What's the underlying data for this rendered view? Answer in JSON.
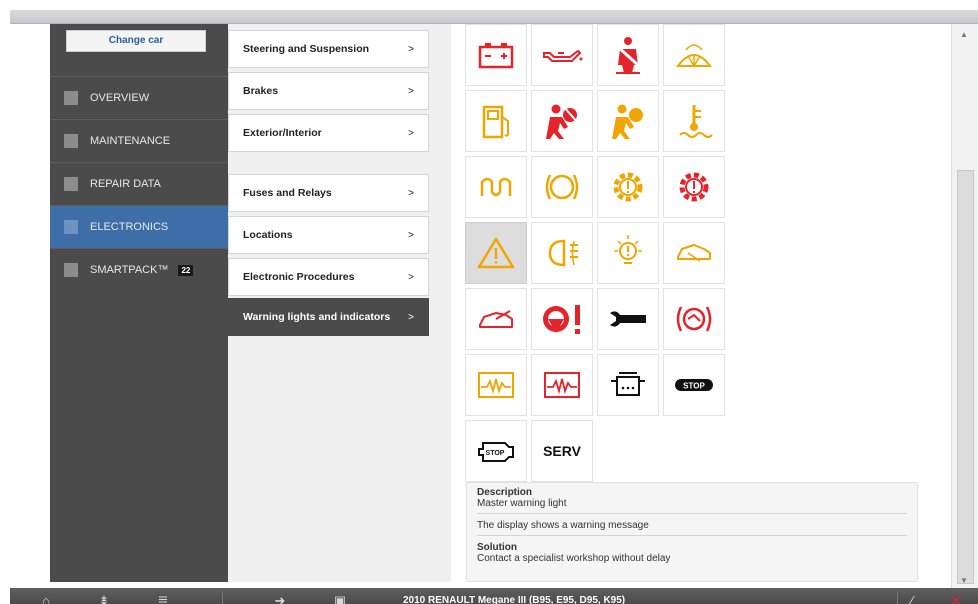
{
  "leftnav": {
    "change_car": "Change car",
    "items": [
      {
        "label": "OVERVIEW"
      },
      {
        "label": "MAINTENANCE"
      },
      {
        "label": "REPAIR DATA"
      },
      {
        "label": "ELECTRONICS"
      },
      {
        "label": "SMARTPACK™",
        "badge": "22"
      }
    ],
    "active": "ELECTRONICS"
  },
  "menu": {
    "items": [
      {
        "label": "Steering and Suspension",
        "chevron": ">"
      },
      {
        "label": "Brakes",
        "chevron": ">"
      },
      {
        "label": "Exterior/Interior",
        "chevron": ">"
      },
      {
        "label": "Fuses and Relays",
        "chevron": ">"
      },
      {
        "label": "Locations",
        "chevron": ">"
      },
      {
        "label": "Electronic Procedures",
        "chevron": ">"
      },
      {
        "label": "Warning lights and indicators",
        "chevron": ">"
      }
    ],
    "active": "Warning lights and indicators"
  },
  "icons": {
    "rows": [
      [
        "battery-warning-icon",
        "oil-pressure-icon",
        "seatbelt-icon",
        "windscreen-washer-icon"
      ],
      [
        "fuel-icon",
        "airbag-off-icon",
        "airbag-icon",
        "coolant-temp-icon"
      ],
      [
        "glow-plug-icon",
        "brake-pad-wear-icon",
        "automatic-transmission-warning-icon",
        "automatic-transmission-fault-icon"
      ],
      [
        "master-warning-icon",
        "rear-fog-light-icon",
        "bulb-failure-icon",
        "door-open-icon"
      ],
      [
        "car-ajar-icon",
        "power-steering-icon",
        "service-wrench-icon",
        "parking-brake-icon"
      ],
      [
        "exhaust-emission-icon",
        "electronic-fault-icon",
        "particle-filter-icon",
        "stop-icon"
      ],
      [
        "engine-stop-icon",
        "serv-icon"
      ]
    ],
    "selected": "master-warning-icon",
    "stop_text": "STOP",
    "serv_text": "SERV",
    "colors": {
      "red": "#e5232b",
      "amber": "#f0a500",
      "black": "#111111"
    }
  },
  "description": {
    "heading": "Description",
    "text": "Master warning light",
    "message": "The display shows a warning message",
    "solution_heading": "Solution",
    "solution": "Contact a specialist workshop without delay"
  },
  "toolbar": {
    "vehicle": "2010 RENAULT Megane III (B95, E95, D95, K95)"
  }
}
